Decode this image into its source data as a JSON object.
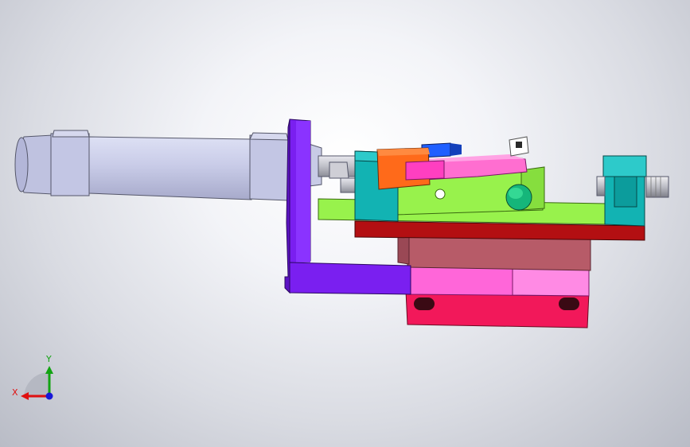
{
  "viewport": {
    "background_center": "#ffffff",
    "background_edge": "#b9bcc6"
  },
  "triad": {
    "x_label": "X",
    "y_label": "Y",
    "x_color": "#e01010",
    "y_color": "#12a312",
    "z_color": "#1818d8"
  },
  "parts": {
    "cylinder_color": "#c9cce8",
    "bracket_color": "#7a1ff0",
    "plate_color": "#98f24c",
    "block_color": "#12b3b3",
    "lever_color": "#ff6ed0",
    "clevis_color": "#ff6a1a",
    "base_top_color": "#b30f12",
    "base_body_color": "#b75b68",
    "base_lower_color": "#ff66d9",
    "base_foot_color": "#f2185a"
  }
}
